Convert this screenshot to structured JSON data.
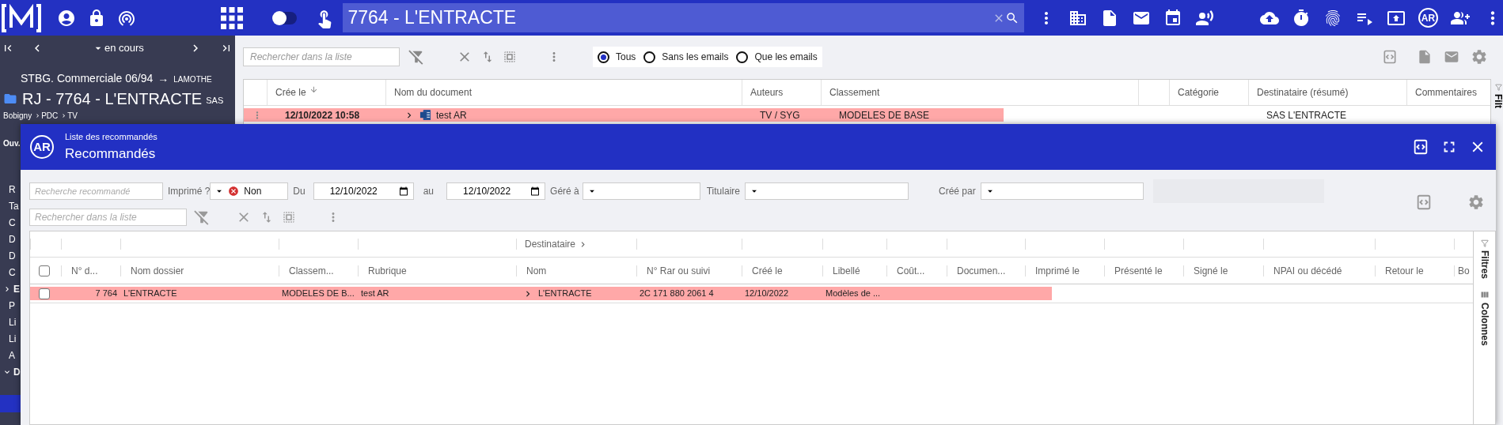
{
  "top_bar": {
    "search_value": "7764 - L'ENTRACTE",
    "avatar": "AR",
    "toggle_on": false
  },
  "sidebar": {
    "period": "en cours",
    "subtitle": "STBG. Commerciale 06/94",
    "subtitle_arrow": "→",
    "subtitle_owner": "LAMOTHE",
    "title": "RJ - 7764 - L'ENTRACTE",
    "title_suffix": "SAS",
    "breadcrumb": [
      "Bobigny",
      "PDC",
      "TV"
    ],
    "status": "Ouv.",
    "items": [
      {
        "label": "R",
        "kind": "item"
      },
      {
        "label": "Ta",
        "kind": "item"
      },
      {
        "label": "C",
        "kind": "item"
      },
      {
        "label": "D",
        "kind": "item"
      },
      {
        "label": "D",
        "kind": "item"
      },
      {
        "label": "C",
        "kind": "item"
      },
      {
        "label": "E",
        "kind": "section",
        "expanded": false
      },
      {
        "label": "P",
        "kind": "item"
      },
      {
        "label": "Li",
        "kind": "item"
      },
      {
        "label": "Li",
        "kind": "item"
      },
      {
        "label": "A",
        "kind": "item"
      },
      {
        "label": "D",
        "kind": "section",
        "expanded": true
      },
      {
        "kind": "active"
      }
    ]
  },
  "list": {
    "search_placeholder": "Rechercher dans la liste",
    "radios": [
      {
        "label": "Tous",
        "selected": true
      },
      {
        "label": "Sans les emails",
        "selected": false
      },
      {
        "label": "Que les emails",
        "selected": false
      }
    ],
    "columns": [
      {},
      {
        "label": "Crée le",
        "sorted": true
      },
      {
        "label": "Nom du document",
        "sorted": false
      },
      {
        "label": "Auteurs",
        "sorted": false
      },
      {
        "label": "Classement",
        "sorted": false
      },
      {},
      {
        "label": "Catégorie",
        "sorted": false
      },
      {
        "label": "Destinataire (résumé)",
        "sorted": false
      },
      {
        "label": "Commentaires",
        "sorted": false
      }
    ],
    "rows": [
      {
        "cells": [
          {
            "kind": "handle",
            "highlighted": true
          },
          {
            "text": "12/10/2022 10:58",
            "bold": true,
            "highlighted": true
          },
          {
            "text": "test AR",
            "kind": "document",
            "highlighted": true
          },
          {
            "text": "TV / SYG",
            "highlighted": true
          },
          {
            "text": "MODELES DE BASE",
            "highlighted": true,
            "partial": true
          },
          {
            "highlighted": false
          },
          {
            "highlighted": false
          },
          {
            "text": "SAS L'ENTRACTE",
            "highlighted": false
          },
          {
            "highlighted": false
          }
        ]
      }
    ],
    "side_tab": "Filt"
  },
  "dialog": {
    "subtitle": "Liste des recommandés",
    "title": "Recommandés",
    "badge": "AR",
    "filters": {
      "search_placeholder": "Recherche recommandé",
      "printed_label": "Imprimé ?",
      "printed_value": "Non",
      "from_label": "Du",
      "from_value": "12/10/2022",
      "to_label": "au",
      "to_value": "12/10/2022",
      "managed_label": "Géré à",
      "holder_label": "Titulaire",
      "created_by_label": "Créé par"
    },
    "list_search_placeholder": "Rechercher dans la liste",
    "columns": [
      {
        "kind": "checkbox",
        "checked": false
      },
      {
        "label": "N° d..."
      },
      {
        "label": "Nom dossier"
      },
      {
        "label": "Classem..."
      },
      {
        "label": "Rubrique"
      },
      {
        "label": "Nom",
        "group": "Destinataire"
      },
      {
        "label": "N° Rar ou suivi"
      },
      {
        "label": "Créé le"
      },
      {
        "label": "Libellé"
      },
      {
        "label": "Coût..."
      },
      {
        "label": "Documen..."
      },
      {
        "label": "Imprimé le"
      },
      {
        "label": "Présenté le"
      },
      {
        "label": "Signé le"
      },
      {
        "label": "NPAI ou décédé"
      },
      {
        "label": "Retour le"
      },
      {
        "label": "Bo"
      }
    ],
    "rows": [
      {
        "cells": [
          {
            "kind": "checkbox",
            "checked": false,
            "highlighted": true
          },
          {
            "text": "7 764",
            "highlighted": true
          },
          {
            "text": "L'ENTRACTE",
            "highlighted": true
          },
          {
            "text": "MODELES DE B...",
            "highlighted": true
          },
          {
            "text": "test AR",
            "highlighted": true
          },
          {
            "text": "L'ENTRACTE",
            "expandable": true,
            "highlighted": true
          },
          {
            "text": "2C 171 880 2061 4",
            "highlighted": true
          },
          {
            "text": "12/10/2022",
            "highlighted": true
          },
          {
            "text": "Modèles de ...",
            "highlighted": true
          },
          {
            "highlighted": true
          },
          {
            "highlighted": true
          },
          {
            "highlighted": true,
            "partial": true
          },
          {
            "highlighted": false
          },
          {
            "highlighted": false
          },
          {
            "highlighted": false
          },
          {
            "highlighted": false
          },
          {
            "highlighted": false
          }
        ]
      }
    ],
    "side_tabs": [
      "Filtres",
      "Colonnes"
    ]
  }
}
